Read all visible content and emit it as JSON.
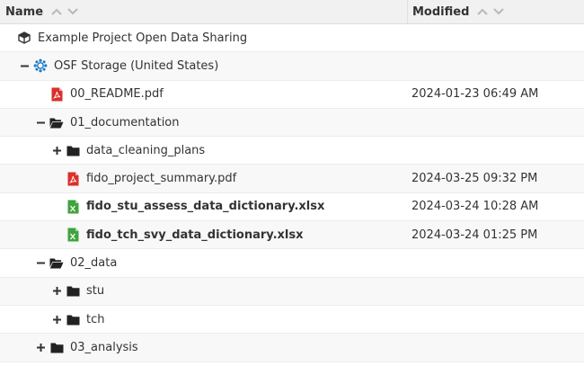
{
  "header": {
    "name_label": "Name",
    "modified_label": "Modified"
  },
  "rows": [
    {
      "label": "Example Project Open Data Sharing",
      "modified": "",
      "icon": "cube-icon",
      "toggle": "",
      "depth": 0,
      "bold": false
    },
    {
      "label": "OSF Storage (United States)",
      "modified": "",
      "icon": "storage-gear-icon",
      "toggle": "minus",
      "depth": 1,
      "bold": false
    },
    {
      "label": "00_README.pdf",
      "modified": "2024-01-23 06:49 AM",
      "icon": "pdf-file-icon",
      "toggle": "",
      "depth": 2,
      "bold": false
    },
    {
      "label": "01_documentation",
      "modified": "",
      "icon": "folder-open-icon",
      "toggle": "minus",
      "depth": 2,
      "bold": false
    },
    {
      "label": "data_cleaning_plans",
      "modified": "",
      "icon": "folder-icon",
      "toggle": "plus",
      "depth": 3,
      "bold": false
    },
    {
      "label": "fido_project_summary.pdf",
      "modified": "2024-03-25 09:32 PM",
      "icon": "pdf-file-icon",
      "toggle": "",
      "depth": 3,
      "bold": false
    },
    {
      "label": "fido_stu_assess_data_dictionary.xlsx",
      "modified": "2024-03-24 10:28 AM",
      "icon": "excel-file-icon",
      "toggle": "",
      "depth": 3,
      "bold": true
    },
    {
      "label": "fido_tch_svy_data_dictionary.xlsx",
      "modified": "2024-03-24 01:25 PM",
      "icon": "excel-file-icon",
      "toggle": "",
      "depth": 3,
      "bold": true
    },
    {
      "label": "02_data",
      "modified": "",
      "icon": "folder-open-icon",
      "toggle": "minus",
      "depth": 2,
      "bold": false
    },
    {
      "label": "stu",
      "modified": "",
      "icon": "folder-icon",
      "toggle": "plus",
      "depth": 3,
      "bold": false
    },
    {
      "label": "tch",
      "modified": "",
      "icon": "folder-icon",
      "toggle": "plus",
      "depth": 3,
      "bold": false
    },
    {
      "label": "03_analysis",
      "modified": "",
      "icon": "folder-icon",
      "toggle": "plus",
      "depth": 2,
      "bold": false
    }
  ],
  "colors": {
    "pdf": "#d9312b",
    "excel": "#3fa33f",
    "folder": "#222222",
    "storage": "#1b78c5"
  }
}
